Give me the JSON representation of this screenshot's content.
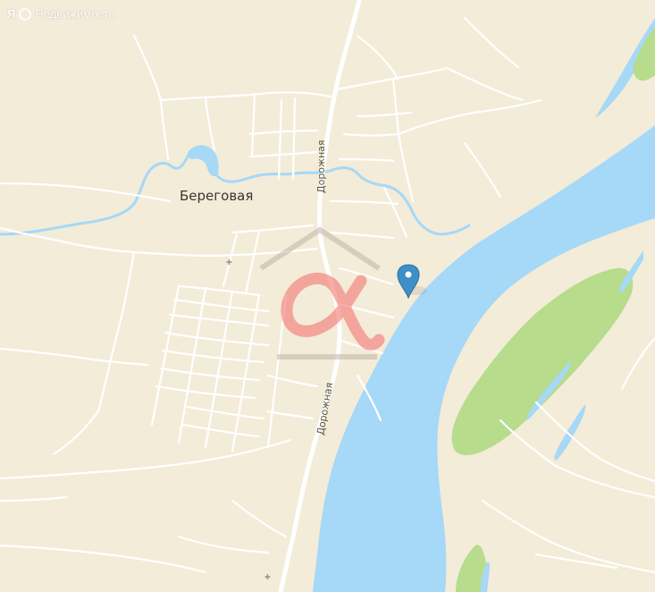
{
  "provider": {
    "logo_letter": "Я",
    "name": "Недвижимость"
  },
  "map": {
    "place_name": "Береговая",
    "road_label_upper": "Дорожная",
    "road_label_lower": "Дорожная",
    "marker_icon": "map-pin-icon",
    "watermark_icon": "alpha-house-logo-icon",
    "colors": {
      "land": "#f3ecd8",
      "water": "#a6d8f7",
      "vegetation": "#b6dc8c",
      "roads": "#ffffff",
      "marker": "#3d8fc6",
      "watermark": "#f46b6b"
    }
  }
}
